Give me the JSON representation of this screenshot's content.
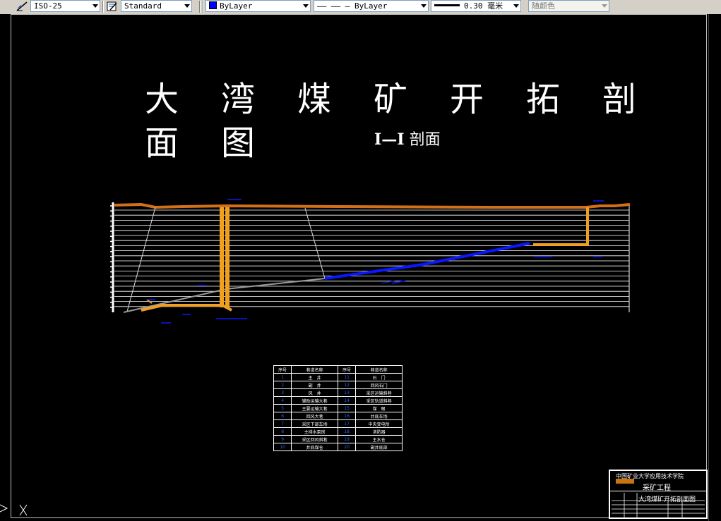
{
  "toolbar": {
    "dimstyle": "ISO-25",
    "textstyle": "Standard",
    "layer_color": "ByLayer",
    "linetype": "—— —— — ByLayer",
    "lineweight": "0.30 毫米",
    "plotstyle": "随颜色",
    "colors": {
      "layer_swatch": "#0000ff"
    }
  },
  "drawing": {
    "title_line1": "大湾煤矿开拓剖",
    "title_line2": "面图",
    "subtitle_roman": "I—I",
    "subtitle_text": "剖面"
  },
  "legend": {
    "headers": [
      "序号",
      "巷道名称",
      "序号",
      "巷道名称"
    ],
    "rows": [
      [
        "1",
        "主　井",
        "11",
        "石　门"
      ],
      [
        "2",
        "副　井",
        "12",
        "回风石门"
      ],
      [
        "3",
        "风　井",
        "13",
        "采区运输斜巷"
      ],
      [
        "4",
        "辅助运输大巷",
        "14",
        "采区轨道斜巷"
      ],
      [
        "5",
        "主要运输大巷",
        "15",
        "煤　眼"
      ],
      [
        "6",
        "回风大巷",
        "16",
        "井底车场"
      ],
      [
        "7",
        "采区下部车场",
        "17",
        "中央变电所"
      ],
      [
        "8",
        "主排水泵房",
        "18",
        "消防器"
      ],
      [
        "9",
        "采区回风斜巷",
        "19",
        "主水仓"
      ],
      [
        "10",
        "井底煤仓",
        "20",
        "副井底部"
      ]
    ]
  },
  "title_block": {
    "school": "中国矿业大学应用技术学院",
    "major": "采矿工程",
    "drawing_name": "大湾煤矿开拓剖面图"
  },
  "colors": {
    "roadway_orange": "#f0a020",
    "seam_blue": "#0a18ff",
    "surface": "#d2701a"
  }
}
